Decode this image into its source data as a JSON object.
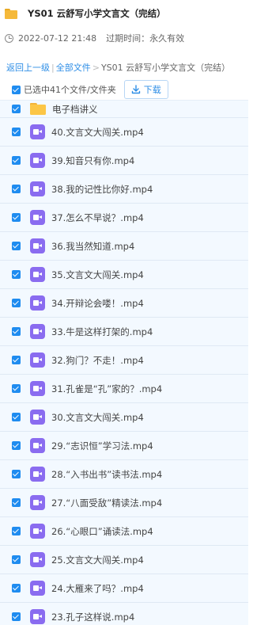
{
  "header": {
    "title": "YS01 云舒写小学文言文（完结）"
  },
  "meta": {
    "created": "2022-07-12 21:48",
    "expiry_label": "过期时间：",
    "expiry_value": "永久有效"
  },
  "breadcrumb": {
    "back": "返回上一级",
    "all_files": "全部文件",
    "current": "YS01 云舒写小学文言文（完结）"
  },
  "toolbar": {
    "selected_text": "已选中41个文件/文件夹",
    "download_label": "下载"
  },
  "colors": {
    "accent": "#2e8ee6",
    "checkbox": "#1f8cf0",
    "video_icon": "#8a6cf0",
    "folder": "#fcc646",
    "row_bg": "#f3f9ff"
  },
  "files": [
    {
      "name": "电子档讲义",
      "icon": "folder-icon",
      "checked": true
    },
    {
      "name": "40.文言文大闯关.mp4",
      "icon": "video-file-icon",
      "checked": true
    },
    {
      "name": "39.知音只有你.mp4",
      "icon": "video-file-icon",
      "checked": true
    },
    {
      "name": "38.我的记性比你好.mp4",
      "icon": "video-file-icon",
      "checked": true
    },
    {
      "name": "37.怎么不早说？.mp4",
      "icon": "video-file-icon",
      "checked": true
    },
    {
      "name": "36.我当然知道.mp4",
      "icon": "video-file-icon",
      "checked": true
    },
    {
      "name": "35.文言文大闯关.mp4",
      "icon": "video-file-icon",
      "checked": true
    },
    {
      "name": "34.开辩论会喽！.mp4",
      "icon": "video-file-icon",
      "checked": true
    },
    {
      "name": "33.牛是这样打架的.mp4",
      "icon": "video-file-icon",
      "checked": true
    },
    {
      "name": "32.狗门？不走！.mp4",
      "icon": "video-file-icon",
      "checked": true
    },
    {
      "name": "31.孔雀是“孔”家的？.mp4",
      "icon": "video-file-icon",
      "checked": true
    },
    {
      "name": "30.文言文大闯关.mp4",
      "icon": "video-file-icon",
      "checked": true
    },
    {
      "name": "29.“志识恒”学习法.mp4",
      "icon": "video-file-icon",
      "checked": true
    },
    {
      "name": "28.“入书出书”读书法.mp4",
      "icon": "video-file-icon",
      "checked": true
    },
    {
      "name": "27.“八面受敌”精读法.mp4",
      "icon": "video-file-icon",
      "checked": true
    },
    {
      "name": "26.“心眼口”诵读法.mp4",
      "icon": "video-file-icon",
      "checked": true
    },
    {
      "name": "25.文言文大闯关.mp4",
      "icon": "video-file-icon",
      "checked": true
    },
    {
      "name": "24.大雁来了吗？.mp4",
      "icon": "video-file-icon",
      "checked": true
    },
    {
      "name": "23.孔子这样说.mp4",
      "icon": "video-file-icon",
      "checked": true
    }
  ]
}
